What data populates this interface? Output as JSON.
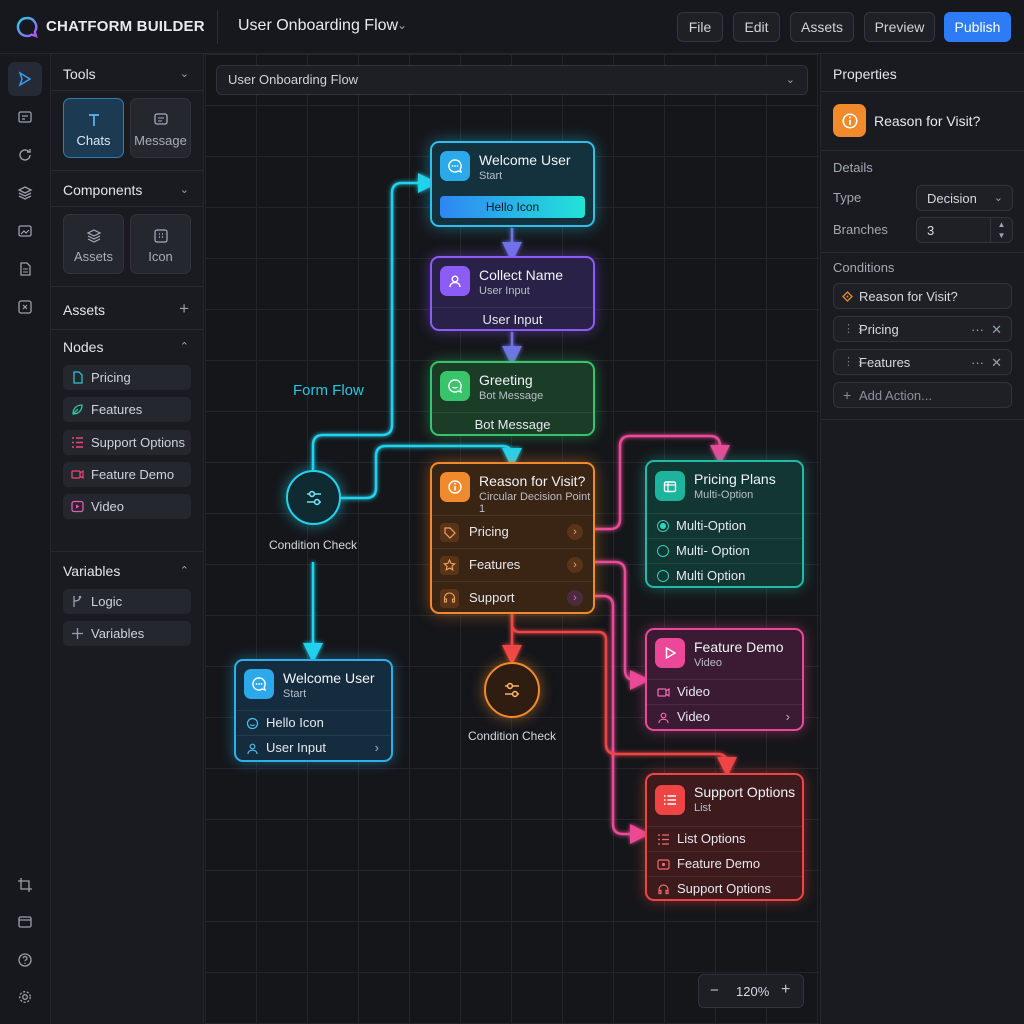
{
  "app": {
    "brand": "CHATFORM BUILDER",
    "flow_title": "User Onboarding Flow"
  },
  "toolbar": {
    "file": "File",
    "edit": "Edit",
    "assets": "Assets",
    "preview": "Preview",
    "publish": "Publish"
  },
  "sidebar": {
    "tools_title": "Tools",
    "tools": [
      {
        "label": "Chats",
        "icon": "text-icon"
      },
      {
        "label": "Message",
        "icon": "message-icon"
      }
    ],
    "components_title": "Components",
    "components": [
      {
        "label": "Assets",
        "icon": "layers-icon"
      },
      {
        "label": "Icon",
        "icon": "grid-icon"
      }
    ],
    "assets_title": "Assets",
    "nodes_title": "Nodes",
    "nodes": [
      {
        "label": "Pricing",
        "icon": "document-icon",
        "color": "#27c4d6"
      },
      {
        "label": "Features",
        "icon": "leaf-icon",
        "color": "#2ec79a"
      },
      {
        "label": "Support Options",
        "icon": "list-icon",
        "color": "#e8477a"
      },
      {
        "label": "Feature Demo",
        "icon": "video-icon",
        "color": "#e8477a"
      },
      {
        "label": "Video",
        "icon": "play-icon",
        "color": "#e857b8"
      }
    ],
    "variables_title": "Variables",
    "variables": [
      {
        "label": "Logic",
        "icon": "branch-icon"
      },
      {
        "label": "Variables",
        "icon": "plus-icon"
      }
    ]
  },
  "canvas": {
    "breadcrumb": "User Onboarding Flow",
    "form_flow_label": "Form Flow",
    "condition_left": "Condition Check",
    "condition_center": "Condition Check",
    "zoom": "120%",
    "nodes": {
      "welcome_top": {
        "title": "Welcome User",
        "sub": "Start",
        "button": "Hello Icon"
      },
      "collect": {
        "title": "Collect Name",
        "sub": "User Input",
        "row": "User Input"
      },
      "greeting": {
        "title": "Greeting",
        "sub": "Bot Message",
        "row": "Bot Message"
      },
      "reason": {
        "title": "Reason for Visit?",
        "sub": "Circular Decision Point 1",
        "rows": [
          "Pricing",
          "Features",
          "Support"
        ]
      },
      "pricing_plans": {
        "title": "Pricing Plans",
        "sub": "Multi-Option",
        "rows": [
          "Multi-Option",
          "Multi- Option",
          "Multi Option"
        ]
      },
      "feature_demo": {
        "title": "Feature Demo",
        "sub": "Video",
        "rows": [
          "Video",
          "Video"
        ]
      },
      "support_options": {
        "title": "Support Options",
        "sub": "List",
        "rows": [
          "List Options",
          "Feature Demo",
          "Support Options"
        ]
      },
      "welcome_bottom": {
        "title": "Welcome User",
        "sub": "Start",
        "rows": [
          "Hello Icon",
          "User Input"
        ]
      }
    }
  },
  "properties": {
    "title": "Properties",
    "selected": "Reason for Visit?",
    "details_title": "Details",
    "type_label": "Type",
    "type_value": "Decision",
    "branches_label": "Branches",
    "branches_value": "3",
    "conditions_title": "Conditions",
    "conditions": [
      "Reason for Visit?",
      "Pricing",
      "Features"
    ],
    "add_action": "Add Action..."
  },
  "colors": {
    "cyan": "#22d3ee",
    "indigo": "#6f73e8",
    "violet": "#8b5cf6",
    "green": "#37c46a",
    "orange": "#f08a2c",
    "teal": "#24b8a6",
    "pink": "#ec4899",
    "red": "#ef4444",
    "blue": "#2d7cf6"
  }
}
